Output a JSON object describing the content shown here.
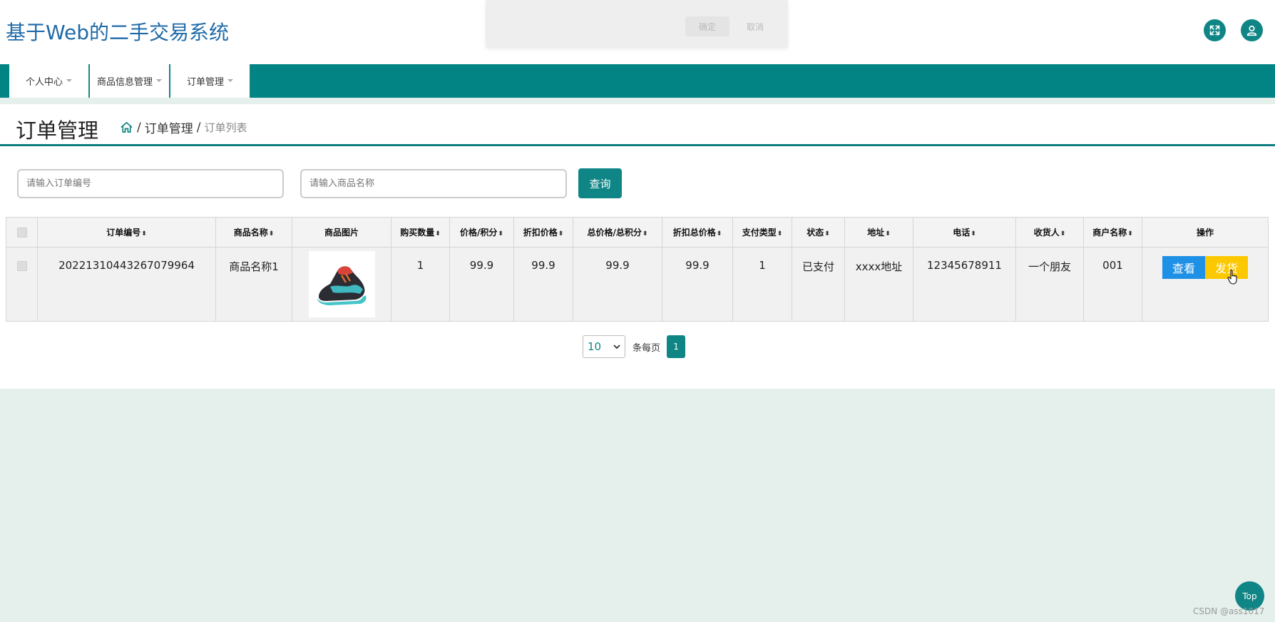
{
  "app": {
    "title": "基于Web的二手交易系统"
  },
  "colors": {
    "primary": "#0f8585",
    "navbar": "#038484",
    "view_button": "#1e90e6",
    "ship_button": "#fcc800",
    "title_text": "#1e6aa8"
  },
  "header_icons": [
    "fullscreen-icon",
    "user-icon"
  ],
  "modal": {
    "confirm_label": "确定",
    "cancel_label": "取消"
  },
  "nav": {
    "items": [
      {
        "label": "个人中心"
      },
      {
        "label": "商品信息管理"
      },
      {
        "label": "订单管理"
      }
    ]
  },
  "page": {
    "title": "订单管理",
    "breadcrumb": {
      "level1": "订单管理",
      "level2": "订单列表",
      "separator": "/"
    }
  },
  "search": {
    "order_no_placeholder": "请输入订单编号",
    "product_name_placeholder": "请输入商品名称",
    "query_label": "查询"
  },
  "table": {
    "headers": [
      "订单编号",
      "商品名称",
      "商品图片",
      "购买数量",
      "价格/积分",
      "折扣价格",
      "总价格/总积分",
      "折扣总价格",
      "支付类型",
      "状态",
      "地址",
      "电话",
      "收货人",
      "商户名称",
      "操作"
    ],
    "sort_glyph": "⬍",
    "rows": [
      {
        "order_no": "20221310443267079964",
        "product_name": "商品名称1",
        "quantity": "1",
        "price": "99.9",
        "discount_price": "99.9",
        "total_price": "99.9",
        "discount_total": "99.9",
        "pay_type": "1",
        "status": "已支付",
        "address": "xxxx地址",
        "phone": "12345678911",
        "receiver": "一个朋友",
        "merchant": "001",
        "view_label": "查看",
        "ship_label": "发货"
      }
    ]
  },
  "pagination": {
    "page_size": "10",
    "per_page_label": "条每页",
    "current_page": "1"
  },
  "top_button": {
    "label": "Top"
  },
  "watermark": "CSDN @ass1017"
}
